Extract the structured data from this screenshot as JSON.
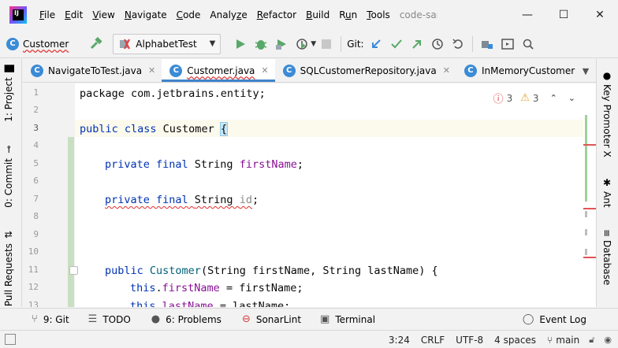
{
  "menubar": {
    "logo_text": "IJ",
    "items": [
      {
        "label": "File",
        "mnemonic": "F"
      },
      {
        "label": "Edit",
        "mnemonic": "E"
      },
      {
        "label": "View",
        "mnemonic": "V"
      },
      {
        "label": "Navigate",
        "mnemonic": "N"
      },
      {
        "label": "Code",
        "mnemonic": "C"
      },
      {
        "label": "Analyze",
        "mnemonic": "z"
      },
      {
        "label": "Refactor",
        "mnemonic": "R"
      },
      {
        "label": "Build",
        "mnemonic": "B"
      },
      {
        "label": "Run",
        "mnemonic": "u"
      },
      {
        "label": "Tools",
        "mnemonic": "T"
      }
    ],
    "window_title": "code-sample",
    "controls": {
      "minimize": "—",
      "maximize": "☐",
      "close": "✕"
    }
  },
  "toolbar": {
    "breadcrumb_label": "Customer",
    "run_config_label": "AlphabetTest",
    "git_label": "Git:"
  },
  "tabs": [
    {
      "label": "NavigateToTest.java",
      "active": false
    },
    {
      "label": "Customer.java",
      "active": true
    },
    {
      "label": "SQLCustomerRepository.java",
      "active": false
    },
    {
      "label": "InMemoryCustomerRepo",
      "active": false
    }
  ],
  "left_tools": [
    {
      "label": "1: Project"
    },
    {
      "label": "0: Commit"
    },
    {
      "label": "Pull Requests"
    }
  ],
  "right_tools": [
    {
      "label": "Key Promoter X"
    },
    {
      "label": "Ant"
    },
    {
      "label": "Database"
    }
  ],
  "editor": {
    "line_numbers": [
      "1",
      "2",
      "3",
      "4",
      "5",
      "6",
      "7",
      "8",
      "9",
      "10",
      "11",
      "12",
      "13"
    ],
    "current_line": "3",
    "inspections": {
      "errors": "3",
      "warnings": "3"
    },
    "code": {
      "l1": "package com.jetbrains.entity;",
      "l3_kw": "public class ",
      "l3_name": "Customer ",
      "l3_brace": "{",
      "l5_kw": "private final ",
      "l5_type": "String ",
      "l5_field": "firstName",
      "l5_end": ";",
      "l7_kw": "private final ",
      "l7_type": "String ",
      "l7_field": "id",
      "l7_end": ";",
      "l11_kw": "public ",
      "l11_rest": "(String firstName, String lastName) {",
      "l11_name": "Customer",
      "l12_kw": "this",
      "l12_dot": ".",
      "l12_field": "firstName",
      "l12_rest": " = firstName;",
      "l13_kw": "this",
      "l13_dot": ".",
      "l13_field": "lastName",
      "l13_rest": " = lastName;"
    }
  },
  "bottom_tools": [
    {
      "label": "9: Git",
      "icon": "git-branch-icon"
    },
    {
      "label": "TODO",
      "icon": "list-icon"
    },
    {
      "label": "6: Problems",
      "icon": "warning-icon"
    },
    {
      "label": "SonarLint",
      "icon": "sonarlint-icon"
    },
    {
      "label": "Terminal",
      "icon": "terminal-icon"
    },
    {
      "label": "Event Log",
      "icon": "event-log-icon"
    }
  ],
  "status": {
    "position": "3:24",
    "line_separator": "CRLF",
    "encoding": "UTF-8",
    "indent": "4 spaces",
    "branch": "main"
  }
}
